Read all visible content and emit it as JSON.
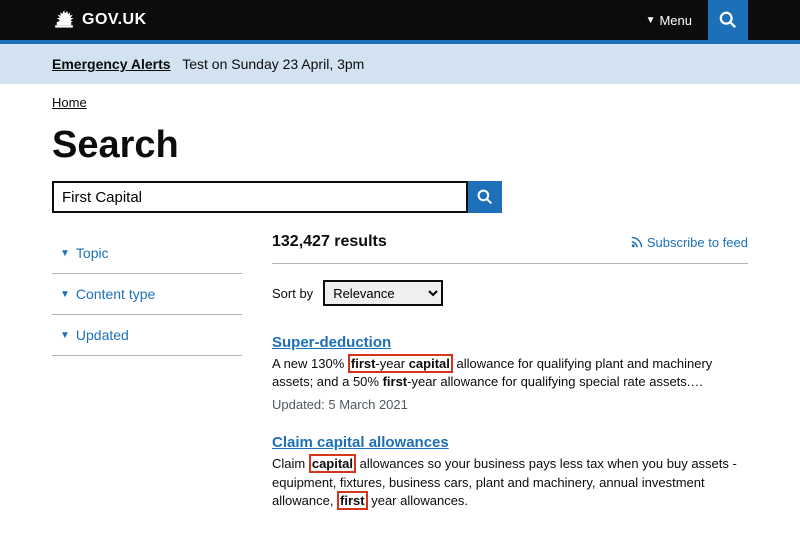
{
  "header": {
    "logo_text": "GOV.UK",
    "menu_label": "Menu"
  },
  "alert": {
    "link": "Emergency Alerts",
    "text": "Test on Sunday 23 April, 3pm"
  },
  "breadcrumb": "Home",
  "page_title": "Search",
  "search": {
    "value": "First Capital"
  },
  "filters": [
    {
      "label": "Topic"
    },
    {
      "label": "Content type"
    },
    {
      "label": "Updated"
    }
  ],
  "results": {
    "count": "132,427 results",
    "subscribe": "Subscribe to feed",
    "sort_label": "Sort by",
    "sort_value": "Relevance"
  },
  "r1": {
    "title": "Super-deduction",
    "d1": "A new 130% ",
    "d2": "first",
    "d3": "-year ",
    "d4": "capital",
    "d5": " allowance for qualifying plant and machinery assets; and a 50% ",
    "d6": "first",
    "d7": "-year allowance for qualifying special rate assets.…",
    "meta": "Updated: 5 March 2021"
  },
  "r2": {
    "title": "Claim capital allowances",
    "d1": "Claim ",
    "d2": "capital",
    "d3": " allowances so your business pays less tax when you buy assets - equipment, fixtures, business cars, plant and machinery, annual investment allowance, ",
    "d4": "first",
    "d5": " year allowances."
  }
}
